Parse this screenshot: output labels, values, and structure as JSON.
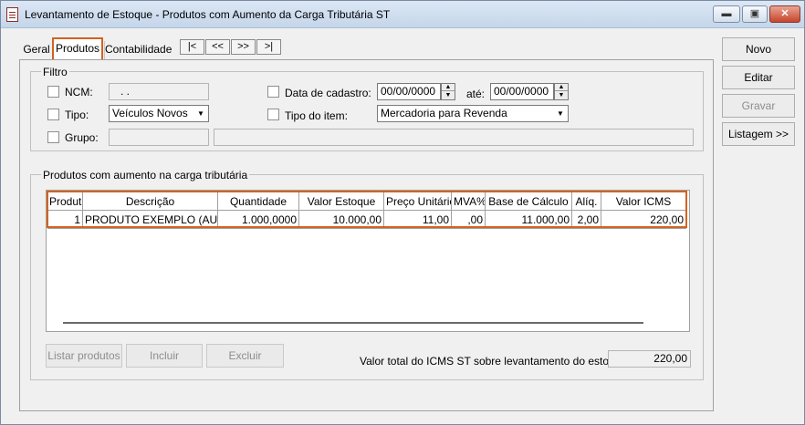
{
  "window": {
    "title": "Levantamento de Estoque - Produtos com Aumento da Carga Tributária ST",
    "min_glyph": "▬",
    "max_glyph": "▣",
    "close_glyph": "✕"
  },
  "tabs": [
    "Geral",
    "Produtos",
    "Contabilidade"
  ],
  "nav_buttons": [
    "|<",
    "<<",
    ">>",
    ">|"
  ],
  "filtro": {
    "legend": "Filtro",
    "ncm_label": "NCM:",
    "ncm_value": ". .",
    "tipo_label": "Tipo:",
    "tipo_value": "Veículos Novos",
    "grupo_label": "Grupo:",
    "grupo_code": "",
    "grupo_desc": "",
    "data_cadastro_label": "Data de cadastro:",
    "data_inicio": "00/00/0000",
    "ate_label": "até:",
    "data_fim": "00/00/0000",
    "tipo_item_label": "Tipo do item:",
    "tipo_item_value": "Mercadoria para Revenda"
  },
  "produtos": {
    "legend": "Produtos com aumento na carga tributária",
    "columns": [
      "Produto",
      "Descrição",
      "Quantidade",
      "Valor Estoque",
      "Preço Unitário",
      "MVA%",
      "Base de Cálculo",
      "Alíq.",
      "Valor ICMS"
    ],
    "rows": [
      [
        "1",
        "PRODUTO EXEMPLO (AUME",
        "1.000,0000",
        "10.000,00",
        "11,00",
        ",00",
        "11.000,00",
        "2,00",
        "220,00"
      ]
    ]
  },
  "buttons": {
    "listar": "Listar produtos",
    "incluir": "Incluir",
    "excluir": "Excluir"
  },
  "total": {
    "label": "Valor total do ICMS ST sobre levantamento do estoque:",
    "value": "220,00"
  },
  "side_buttons": {
    "novo": "Novo",
    "editar": "Editar",
    "gravar": "Gravar",
    "listagem": "Listagem >>"
  },
  "colors": {
    "highlight": "#d4621f"
  }
}
